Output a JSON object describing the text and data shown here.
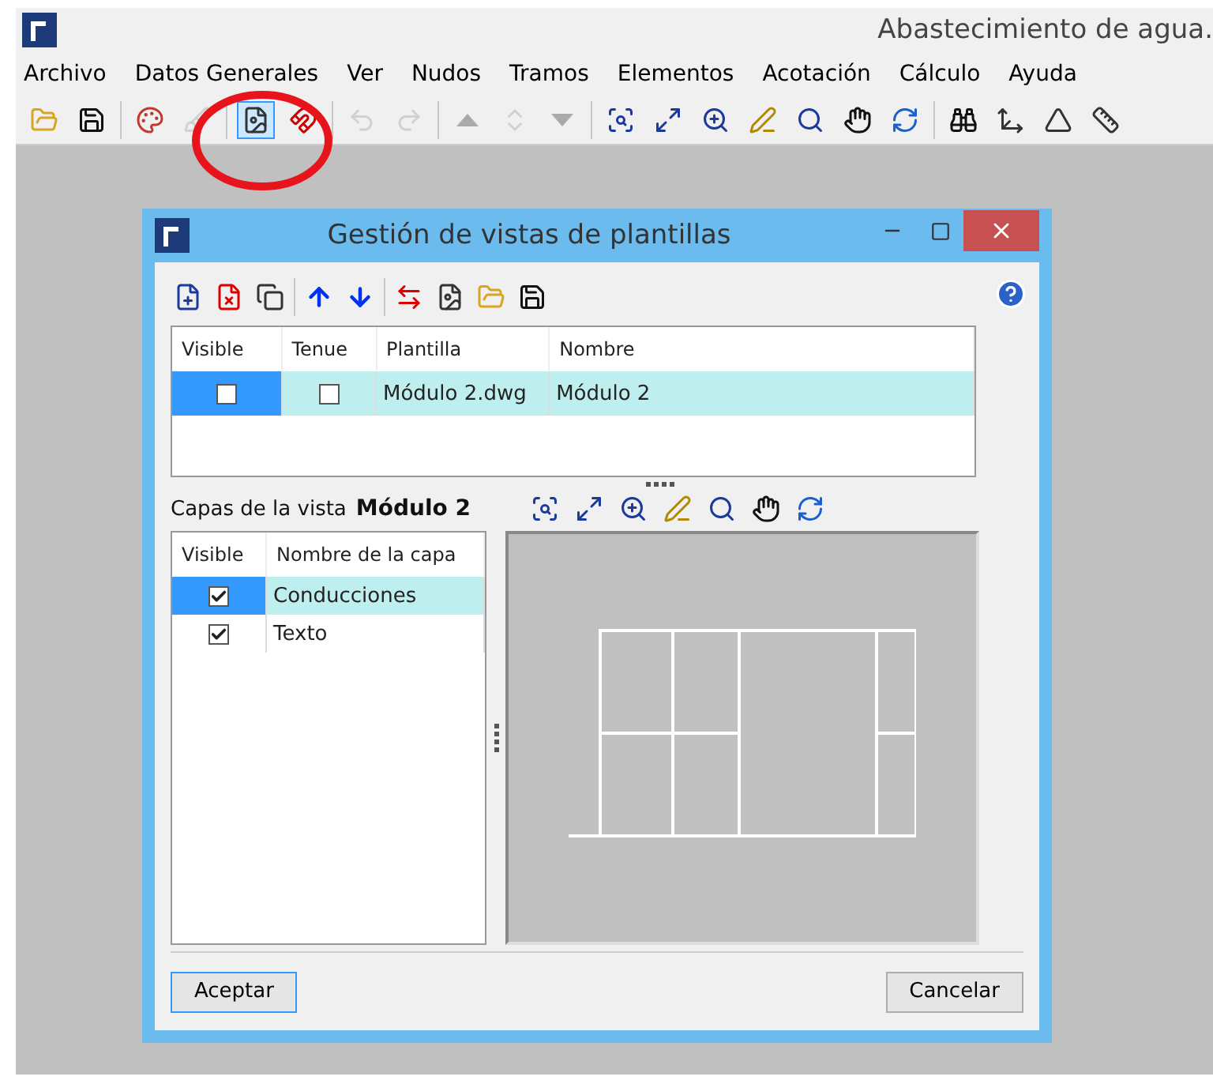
{
  "app": {
    "title": "Abastecimiento de agua."
  },
  "menu": [
    {
      "label": "Archivo"
    },
    {
      "label": "Datos Generales"
    },
    {
      "label": "Ver"
    },
    {
      "label": "Nudos"
    },
    {
      "label": "Tramos"
    },
    {
      "label": "Elementos"
    },
    {
      "label": "Acotación"
    },
    {
      "label": "Cálculo"
    },
    {
      "label": "Ayuda"
    }
  ],
  "toolbar": [
    {
      "kind": "open",
      "disabled": false,
      "selected": false
    },
    {
      "kind": "save",
      "disabled": false,
      "selected": false
    },
    {
      "kind": "sep"
    },
    {
      "kind": "palette",
      "disabled": false,
      "selected": false
    },
    {
      "kind": "brush",
      "disabled": true,
      "selected": false
    },
    {
      "kind": "sep"
    },
    {
      "kind": "dxf",
      "disabled": false,
      "selected": true
    },
    {
      "kind": "magnet",
      "disabled": false,
      "selected": false
    },
    {
      "kind": "sep"
    },
    {
      "kind": "undo",
      "disabled": true,
      "selected": false
    },
    {
      "kind": "redo",
      "disabled": true,
      "selected": false
    },
    {
      "kind": "sep"
    },
    {
      "kind": "up",
      "disabled": true,
      "selected": false
    },
    {
      "kind": "updown",
      "disabled": true,
      "selected": false
    },
    {
      "kind": "down",
      "disabled": true,
      "selected": false
    },
    {
      "kind": "sep"
    },
    {
      "kind": "zoomall",
      "disabled": false,
      "selected": false
    },
    {
      "kind": "zoomwin",
      "disabled": false,
      "selected": false
    },
    {
      "kind": "zoomx2",
      "disabled": false,
      "selected": false
    },
    {
      "kind": "pen",
      "disabled": false,
      "selected": false
    },
    {
      "kind": "zoomsel",
      "disabled": false,
      "selected": false
    },
    {
      "kind": "hand",
      "disabled": false,
      "selected": false
    },
    {
      "kind": "refresh",
      "disabled": false,
      "selected": false
    },
    {
      "kind": "sep"
    },
    {
      "kind": "binoculars",
      "disabled": false,
      "selected": false
    },
    {
      "kind": "axes",
      "disabled": false,
      "selected": false
    },
    {
      "kind": "angle",
      "disabled": false,
      "selected": false
    },
    {
      "kind": "measure",
      "disabled": false,
      "selected": false
    }
  ],
  "dialog": {
    "title": "Gestión de vistas de plantillas",
    "toolbar": [
      {
        "kind": "new"
      },
      {
        "kind": "delete"
      },
      {
        "kind": "copy"
      },
      {
        "kind": "sep"
      },
      {
        "kind": "arrowup"
      },
      {
        "kind": "arrowdown"
      },
      {
        "kind": "sep"
      },
      {
        "kind": "swap"
      },
      {
        "kind": "dxf"
      },
      {
        "kind": "open"
      },
      {
        "kind": "save"
      }
    ],
    "templates": {
      "columns": [
        "Visible",
        "Tenue",
        "Plantilla",
        "Nombre"
      ],
      "rows": [
        {
          "visible": false,
          "tenue": false,
          "plantilla": "Módulo 2.dwg",
          "nombre": "Módulo 2",
          "selected": true
        }
      ]
    },
    "layers_label": "Capas de la vista",
    "layers_view": "Módulo 2",
    "view_toolbar": [
      {
        "kind": "zoomall"
      },
      {
        "kind": "zoomwin"
      },
      {
        "kind": "zoomx2"
      },
      {
        "kind": "pen"
      },
      {
        "kind": "zoomsel"
      },
      {
        "kind": "hand"
      },
      {
        "kind": "refresh"
      }
    ],
    "layers": {
      "columns": [
        "Visible",
        "Nombre de la capa"
      ],
      "rows": [
        {
          "visible": true,
          "name": "Conducciones",
          "selected": true
        },
        {
          "visible": true,
          "name": "Texto",
          "selected": false
        }
      ]
    },
    "buttons": [
      {
        "label": "Aceptar",
        "default": true
      },
      {
        "label": "Cancelar",
        "default": false
      }
    ]
  }
}
